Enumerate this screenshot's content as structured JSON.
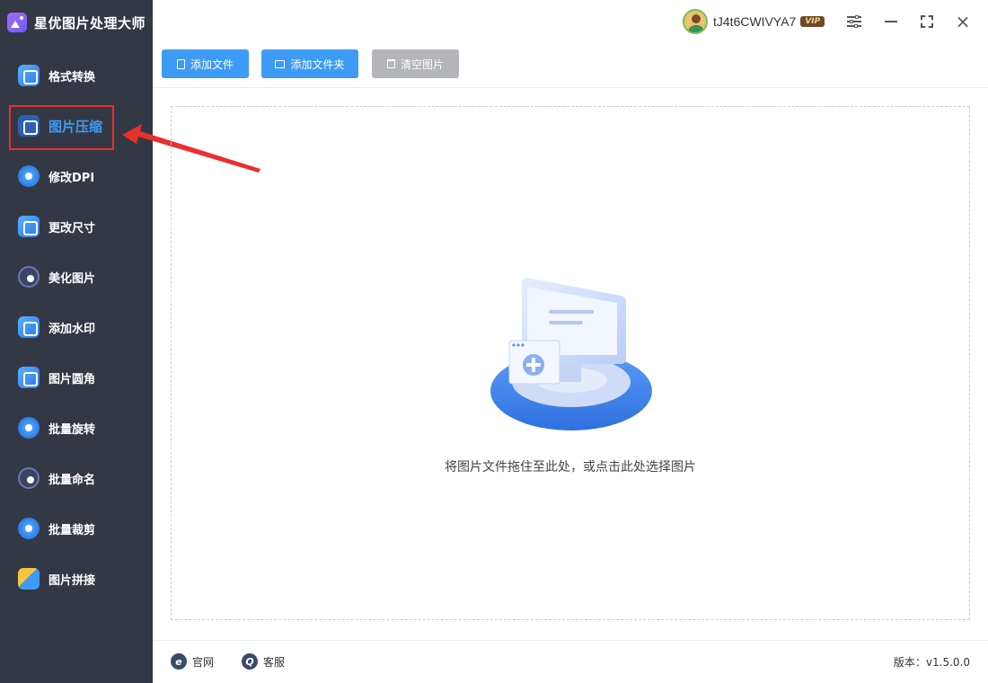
{
  "app": {
    "title": "星优图片处理大师"
  },
  "user": {
    "name": "tJ4t6CWIVYA7",
    "badge": "VIP"
  },
  "sidebar": {
    "items": [
      {
        "label": "格式转换",
        "icon": "image-convert-icon"
      },
      {
        "label": "图片压缩",
        "icon": "image-compress-icon",
        "active": true
      },
      {
        "label": "修改DPI",
        "icon": "dpi-icon"
      },
      {
        "label": "更改尺寸",
        "icon": "resize-icon"
      },
      {
        "label": "美化图片",
        "icon": "beautify-icon"
      },
      {
        "label": "添加水印",
        "icon": "watermark-icon"
      },
      {
        "label": "图片圆角",
        "icon": "round-corner-icon"
      },
      {
        "label": "批量旋转",
        "icon": "rotate-icon"
      },
      {
        "label": "批量命名",
        "icon": "rename-icon"
      },
      {
        "label": "批量裁剪",
        "icon": "crop-icon"
      },
      {
        "label": "图片拼接",
        "icon": "stitch-icon"
      }
    ]
  },
  "toolbar": {
    "add_file": "添加文件",
    "add_folder": "添加文件夹",
    "clear": "清空图片"
  },
  "dropzone": {
    "hint": "将图片文件拖住至此处，或点击此处选择图片"
  },
  "footer": {
    "website": "官网",
    "support": "客服",
    "version": "版本：v1.5.0.0"
  },
  "colors": {
    "sidebar_bg": "#343844",
    "accent": "#3d9bf5",
    "highlight_border": "#e8302e",
    "disabled_button": "#b3b5b9"
  }
}
